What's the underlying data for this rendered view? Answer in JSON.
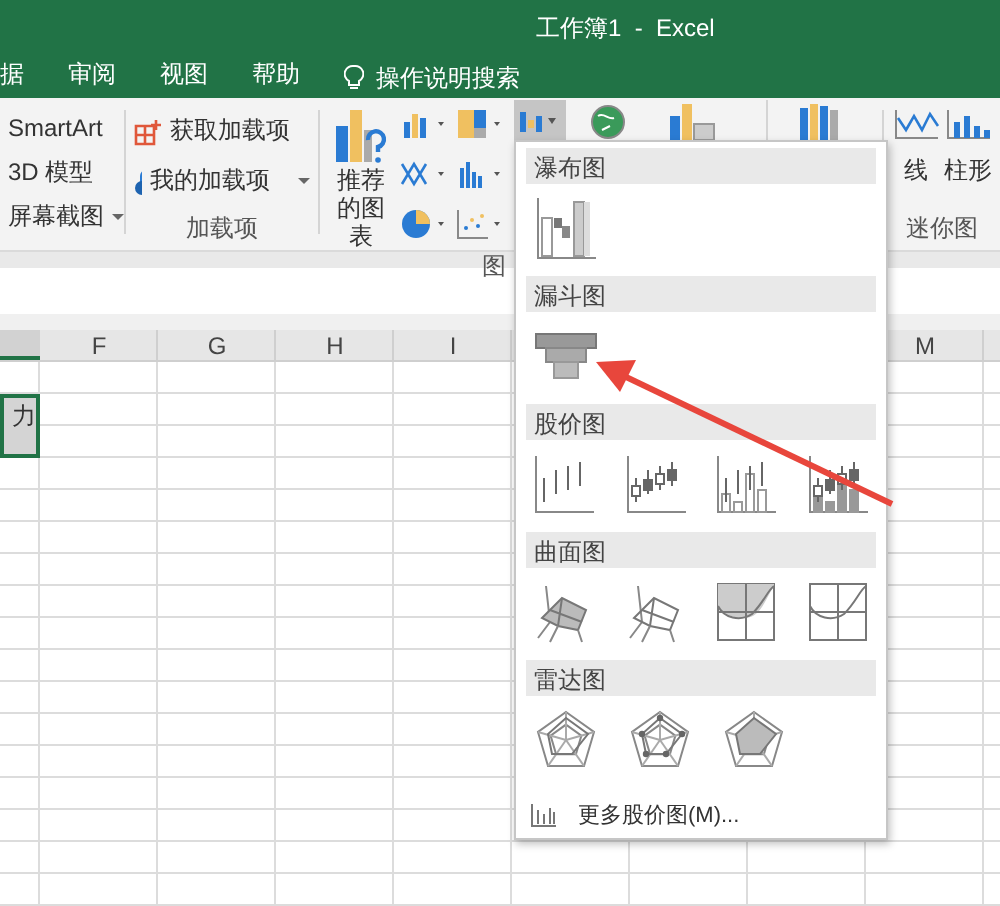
{
  "window": {
    "title": "工作簿1  -  Excel"
  },
  "tabs": [
    {
      "label": "据",
      "selected": false
    },
    {
      "label": "审阅",
      "selected": false
    },
    {
      "label": "视图",
      "selected": false
    },
    {
      "label": "帮助",
      "selected": false
    }
  ],
  "tell_me": {
    "placeholder": "操作说明搜索"
  },
  "ribbon": {
    "illustrations": [
      {
        "label": "SmartArt",
        "dropdown": false
      },
      {
        "label": "3D 模型",
        "dropdown": false
      },
      {
        "label": "屏幕截图",
        "dropdown": true
      }
    ],
    "addins": {
      "label": "加载项",
      "items": [
        {
          "label": "获取加载项",
          "kind": "store",
          "dropdown": false
        },
        {
          "label": "我的加载项",
          "kind": "mine",
          "dropdown": true
        }
      ]
    },
    "charts": {
      "label": "图",
      "recommended": "推荐的图表",
      "waterfall_pressed": true
    },
    "sparklines": {
      "label": "迷你图",
      "items": [
        {
          "label": "线",
          "kind": "line"
        },
        {
          "label": "柱形",
          "kind": "column"
        }
      ]
    }
  },
  "sheet": {
    "columns": [
      "F",
      "G",
      "H",
      "I",
      null,
      null,
      null,
      "M"
    ],
    "selected_range": {
      "text": "力",
      "selected": true
    }
  },
  "menu": {
    "sections": [
      {
        "title": "瀑布图",
        "items": [
          {
            "kind": "waterfall"
          }
        ]
      },
      {
        "title": "漏斗图",
        "items": [
          {
            "kind": "funnel"
          }
        ]
      },
      {
        "title": "股价图",
        "items": [
          {
            "kind": "hlc"
          },
          {
            "kind": "ohlc"
          },
          {
            "kind": "vhlc"
          },
          {
            "kind": "vohlc"
          }
        ]
      },
      {
        "title": "曲面图",
        "items": [
          {
            "kind": "surface"
          },
          {
            "kind": "wire"
          },
          {
            "kind": "contour"
          },
          {
            "kind": "wirecontour"
          }
        ]
      },
      {
        "title": "雷达图",
        "items": [
          {
            "kind": "radar"
          },
          {
            "kind": "radarmarkers"
          },
          {
            "kind": "radarfilled"
          }
        ]
      }
    ],
    "more": "更多股价图(M)..."
  },
  "annotation": {
    "kind": "arrow"
  }
}
